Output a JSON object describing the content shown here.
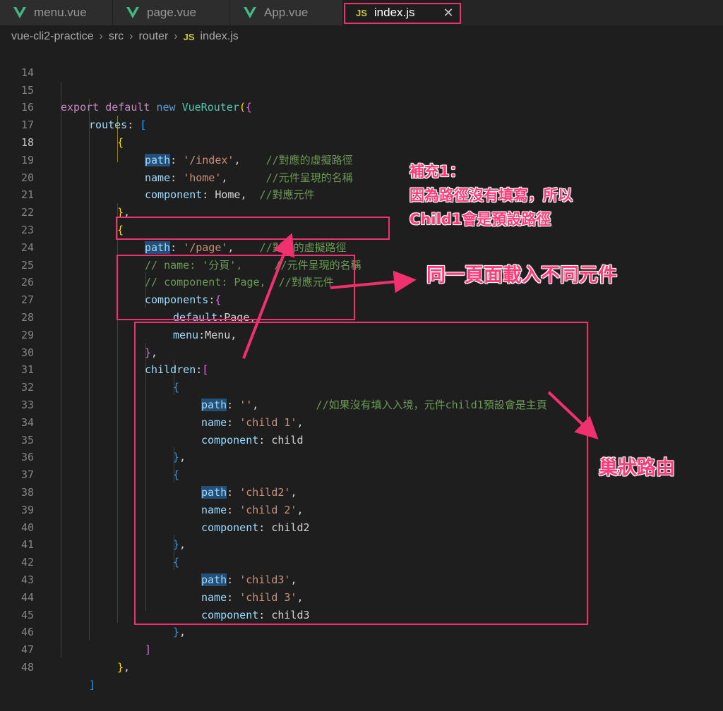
{
  "tabs": [
    {
      "label": "menu.vue",
      "icon": "vue-icon",
      "active": false
    },
    {
      "label": "page.vue",
      "icon": "vue-icon",
      "active": false
    },
    {
      "label": "App.vue",
      "icon": "vue-icon",
      "active": false
    },
    {
      "label": "index.js",
      "icon": "js-icon",
      "active": true
    }
  ],
  "js_icon_text": "JS",
  "close_glyph": "✕",
  "breadcrumb": [
    "vue-cli2-practice",
    "src",
    "router",
    "index.js"
  ],
  "current_line": 18,
  "line_numbers": [
    "14",
    "15",
    "16",
    "17",
    "18",
    "19",
    "20",
    "21",
    "22",
    "23",
    "24",
    "25",
    "26",
    "27",
    "28",
    "29",
    "30",
    "31",
    "32",
    "33",
    "34",
    "35",
    "36",
    "37",
    "38",
    "39",
    "40",
    "41",
    "42",
    "43",
    "44",
    "45",
    "46",
    "47",
    "48"
  ],
  "code": {
    "l15": {
      "kw1": "export",
      "kw2": "default",
      "kw3": "new",
      "cls": "VueRouter",
      "p": "("
    },
    "l16": {
      "prop": "routes",
      "colon": ": ",
      "br": "["
    },
    "l17": {
      "br": "{"
    },
    "l18": {
      "prop": "path",
      "rest": ": ",
      "str": "'/index'",
      "comma": ",",
      "cmt": "    //對應的虛擬路徑"
    },
    "l19": {
      "prop": "name",
      "rest": ": ",
      "str": "'home'",
      "comma": ",",
      "cmt": "      //元件呈現的名稱"
    },
    "l20": {
      "prop": "component",
      "rest": ": Home,",
      "cmt": "  //對應元件"
    },
    "l21": {
      "br": "}",
      "comma": ","
    },
    "l22": {
      "br": "{"
    },
    "l23": {
      "prop": "path",
      "rest": ": ",
      "str": "'/page'",
      "comma": ",",
      "cmt": "    //對應的虛擬路徑"
    },
    "l24": {
      "cmt": "// name: '分頁',     //元件呈現的名稱"
    },
    "l25": {
      "cmt": "// component: Page,  //對應元件"
    },
    "l26": {
      "prop": "components",
      "rest": ":",
      "br": "{"
    },
    "l27": {
      "prop": "default",
      "rest": ":Page,"
    },
    "l28": {
      "prop": "menu",
      "rest": ":Menu,"
    },
    "l29": {
      "br": "}",
      "comma": ","
    },
    "l30": {
      "prop": "children",
      "rest": ":",
      "br": "["
    },
    "l31": {
      "br": "{"
    },
    "l32": {
      "prop": "path",
      "rest": ": ",
      "str": "''",
      "comma": ",",
      "cmt": "         //如果沒有填入入境，元件child1預設會是主頁"
    },
    "l33": {
      "prop": "name",
      "rest": ": ",
      "str": "'child 1'",
      "comma": ","
    },
    "l34": {
      "prop": "component",
      "rest": ": child"
    },
    "l35": {
      "br": "}",
      "comma": ","
    },
    "l36": {
      "br": "{"
    },
    "l37": {
      "prop": "path",
      "rest": ": ",
      "str": "'child2'",
      "comma": ","
    },
    "l38": {
      "prop": "name",
      "rest": ": ",
      "str": "'child 2'",
      "comma": ","
    },
    "l39": {
      "prop": "component",
      "rest": ": child2"
    },
    "l40": {
      "br": "}",
      "comma": ","
    },
    "l41": {
      "br": "{"
    },
    "l42": {
      "prop": "path",
      "rest": ": ",
      "str": "'child3'",
      "comma": ","
    },
    "l43": {
      "prop": "name",
      "rest": ": ",
      "str": "'child 3'",
      "comma": ","
    },
    "l44": {
      "prop": "component",
      "rest": ": child3"
    },
    "l45": {
      "br": "}",
      "comma": ","
    },
    "l46": {
      "br": "]"
    },
    "l47": {
      "br": "}",
      "comma": ","
    },
    "l48": {
      "br": "]"
    }
  },
  "annotations": {
    "note1": [
      "補充1：",
      "因為路徑沒有填寫，所以",
      "Child1會是預設路徑"
    ],
    "note2": "同一頁面載入不同元件",
    "note3": "巢狀路由",
    "color": "#f1306f"
  }
}
